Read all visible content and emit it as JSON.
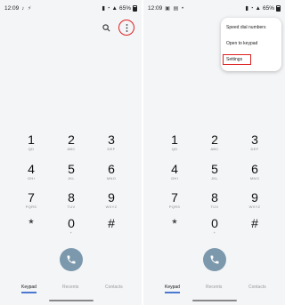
{
  "status_bar": {
    "time": "12:09",
    "battery": "65%"
  },
  "overflow_menu": {
    "items": [
      {
        "label": "Speed dial numbers"
      },
      {
        "label": "Open to keypad"
      },
      {
        "label": "Settings",
        "highlighted": true
      }
    ]
  },
  "keypad": {
    "keys": [
      {
        "digit": "1",
        "sub": "QD"
      },
      {
        "digit": "2",
        "sub": "ABC"
      },
      {
        "digit": "3",
        "sub": "DEF"
      },
      {
        "digit": "4",
        "sub": "GHI"
      },
      {
        "digit": "5",
        "sub": "JKL"
      },
      {
        "digit": "6",
        "sub": "MNO"
      },
      {
        "digit": "7",
        "sub": "PQRS"
      },
      {
        "digit": "8",
        "sub": "TUV"
      },
      {
        "digit": "9",
        "sub": "WXYZ"
      },
      {
        "digit": "*",
        "sub": ""
      },
      {
        "digit": "0",
        "sub": "+"
      },
      {
        "digit": "#",
        "sub": ""
      }
    ]
  },
  "tabs": [
    {
      "label": "Keypad",
      "active": true
    },
    {
      "label": "Recents"
    },
    {
      "label": "Contacts"
    }
  ],
  "colors": {
    "highlight": "#dd2222",
    "call_button": "#7c98ad",
    "tab_underline": "#4a78d0"
  }
}
